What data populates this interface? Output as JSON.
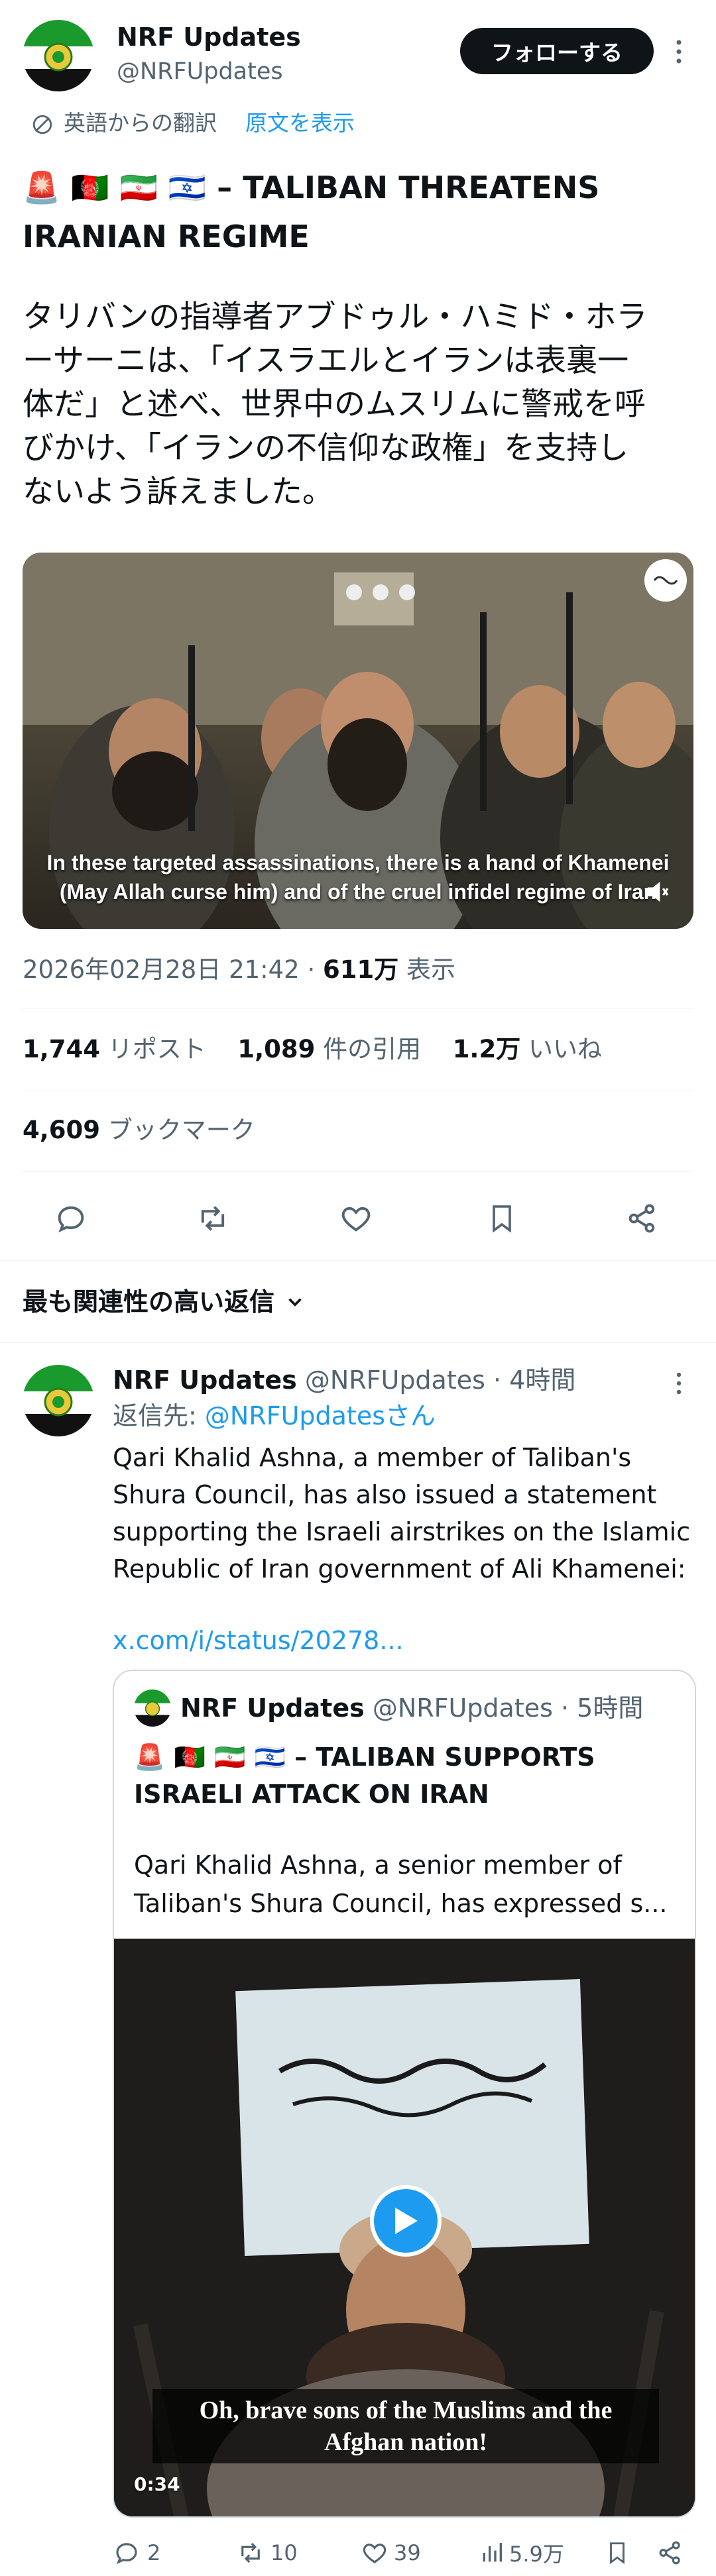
{
  "post": {
    "author_name": "NRF Updates",
    "author_handle": "@NRFUpdates",
    "follow_label": "フォローする",
    "translation_note": "英語からの翻訳",
    "show_original": "原文を表示",
    "title_flags": "🚨 🇦🇫 🇮🇷 🇮🇱 –",
    "title_line1": "TALIBAN THREATENS",
    "title_line2": "IRANIAN REGIME",
    "body_lines": [
      "タリバンの指導者アブドゥル・ハミド・ホラ",
      "ーサーニは、「イスラエルとイランは表裏一",
      "体だ」と述べ、世界中のムスリムに警戒を呼",
      "びかけ、「イランの不信仰な政権」を支持し",
      "ないよう訴えました。"
    ],
    "video_caption_line1": "In these targeted assassinations, there is a hand of Khamenei",
    "video_caption_line2": "(May Allah curse him) and of the cruel infidel regime of Iran",
    "timestamp": "2026年02月28日 21:42 · ",
    "views_count": "611万",
    "views_label": " 表示",
    "reposts_count": "1,744",
    "reposts_label": "リポスト",
    "quotes_count": "1,089",
    "quotes_label": "件の引用",
    "likes_count": "1.2万",
    "likes_label": "いいね",
    "bookmarks_count": "4,609",
    "bookmarks_label": "ブックマーク"
  },
  "replies_header": "最も関連性の高い返信",
  "reply": {
    "author_name": "NRF Updates",
    "author_handle": "@NRFUpdates",
    "time": "· 4時間",
    "reply_to_prefix": "返信先: ",
    "reply_to_handle": "@NRFUpdatesさん",
    "body_lines": [
      "Qari Khalid Ashna, a member of Taliban's",
      "Shura Council, has also issued a statement",
      "supporting the Israeli airstrikes on the Islamic",
      "Republic of Iran government of Ali Khamenei:"
    ],
    "link": "x.com/i/status/20278...",
    "quote": {
      "author_name": "NRF Updates",
      "author_handle": "@NRFUpdates",
      "time": "· 5時間",
      "title_flags": "🚨 🇦🇫 🇮🇷 🇮🇱 –",
      "title_line1": "TALIBAN SUPPORTS",
      "title_line2": "ISRAELI ATTACK ON IRAN",
      "body_line1": "Qari Khalid Ashna, a senior member of",
      "body_line2": "Taliban's Shura Council, has expressed s...",
      "video_caption_line1": "Oh, brave sons of the Muslims and the",
      "video_caption_line2": "Afghan nation!",
      "video_duration": "0:34"
    },
    "actions": {
      "replies": "2",
      "reposts": "10",
      "likes": "39",
      "views": "5.9万"
    }
  },
  "colors": {
    "accent": "#1d9bf0",
    "text": "#0f1419",
    "muted": "#536471",
    "divider": "#eff3f4",
    "follow_bg": "#0f1419"
  }
}
